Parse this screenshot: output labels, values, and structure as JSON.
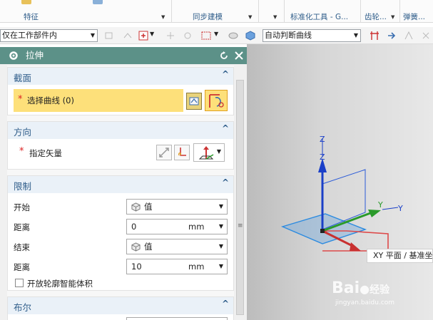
{
  "ribbon": {
    "groups": [
      "特征",
      "同步建模",
      "标准化工具 - G...",
      "齿轮...",
      "弹簧..."
    ]
  },
  "toolbar2": {
    "filter_combo": "仅在工作部件内",
    "curve_rule_combo": "自动判断曲线"
  },
  "dialog": {
    "title": "拉伸",
    "sections": {
      "section_curve": {
        "label": "截面",
        "select_curve": "选择曲线 (0)"
      },
      "direction": {
        "label": "方向",
        "specify_vector": "指定矢量"
      },
      "limits": {
        "label": "限制",
        "start_label": "开始",
        "start_value": "值",
        "start_distance_label": "距离",
        "start_distance": "0",
        "start_unit": "mm",
        "end_label": "结束",
        "end_value": "值",
        "end_distance_label": "距离",
        "end_distance": "10",
        "end_unit": "mm",
        "open_profile": "开放轮廓智能体积"
      },
      "boolean": {
        "label": "布尔"
      }
    }
  },
  "viewport": {
    "axis_z": "Z",
    "axis_y": "Y",
    "tooltip": "XY 平面 / 基准坐"
  },
  "watermark": {
    "brand": "Bai",
    "brand2": "经验",
    "url": "jingyan.baidu.com"
  },
  "colors": {
    "title_bar": "#5c9188",
    "selection_highlight": "#fde07a",
    "accent_blue": "#2f5d8a",
    "required_star": "#d22222"
  }
}
